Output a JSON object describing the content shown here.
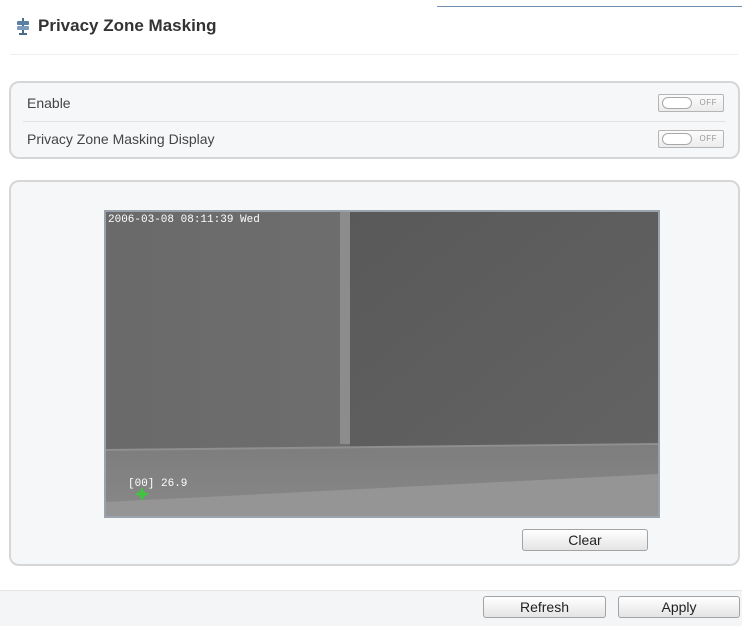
{
  "page": {
    "title": "Privacy Zone Masking",
    "title_icon": "privacy-sign-icon"
  },
  "settings": [
    {
      "label": "Enable",
      "toggle_state": "OFF"
    },
    {
      "label": "Privacy Zone Masking Display",
      "toggle_state": "OFF"
    }
  ],
  "video": {
    "osd_timestamp": "2006-03-08 08:11:39 Wed",
    "osd_temperature": "[00] 26.9",
    "marker_icon": "crosshair-marker-icon"
  },
  "buttons": {
    "clear_label": "Clear",
    "refresh_label": "Refresh",
    "apply_label": "Apply"
  },
  "colors": {
    "accent_line": "#6f8fb0",
    "panel_bg": "#f6f7f9",
    "panel_border": "#d6d6d6",
    "marker": "#3cc83c"
  }
}
